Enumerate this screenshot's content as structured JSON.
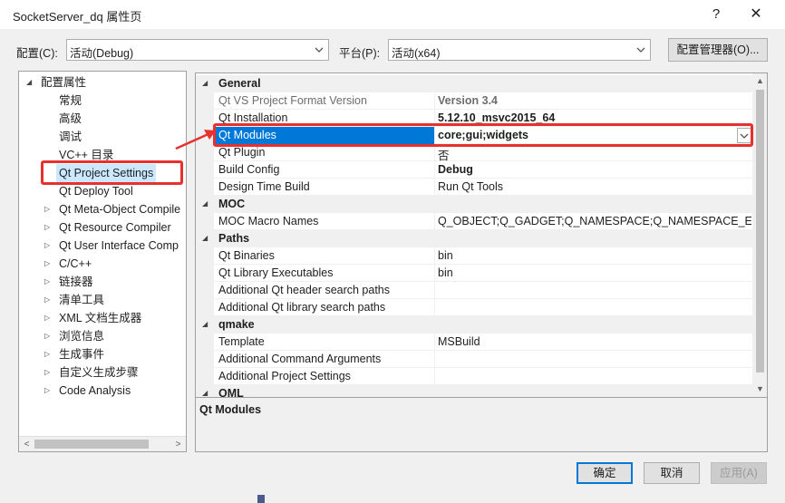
{
  "window": {
    "title": "SocketServer_dq 属性页",
    "help_glyph": "?",
    "close_glyph": "✕"
  },
  "toolbar": {
    "config_label": "配置(C):",
    "config_value": "活动(Debug)",
    "platform_label": "平台(P):",
    "platform_value": "活动(x64)",
    "config_manager_label": "配置管理器(O)..."
  },
  "tree": {
    "root": "配置属性",
    "items": [
      {
        "label": "常规",
        "expandable": false
      },
      {
        "label": "高级",
        "expandable": false
      },
      {
        "label": "调试",
        "expandable": false
      },
      {
        "label": "VC++ 目录",
        "expandable": false
      },
      {
        "label": "Qt Project Settings",
        "expandable": false,
        "selected": true
      },
      {
        "label": "Qt Deploy Tool",
        "expandable": false
      },
      {
        "label": "Qt Meta-Object Compile",
        "expandable": true
      },
      {
        "label": "Qt Resource Compiler",
        "expandable": true
      },
      {
        "label": "Qt User Interface Comp",
        "expandable": true
      },
      {
        "label": "C/C++",
        "expandable": true
      },
      {
        "label": "链接器",
        "expandable": true
      },
      {
        "label": "清单工具",
        "expandable": true
      },
      {
        "label": "XML 文档生成器",
        "expandable": true
      },
      {
        "label": "浏览信息",
        "expandable": true
      },
      {
        "label": "生成事件",
        "expandable": true
      },
      {
        "label": "自定义生成步骤",
        "expandable": true
      },
      {
        "label": "Code Analysis",
        "expandable": true
      }
    ]
  },
  "grid": {
    "sections": [
      {
        "name": "General",
        "rows": [
          {
            "name": "Qt VS Project Format Version",
            "value": "Version 3.4",
            "disabled": true,
            "bold": true
          },
          {
            "name": "Qt Installation",
            "value": "5.12.10_msvc2015_64",
            "bold": true
          },
          {
            "name": "Qt Modules",
            "value": "core;gui;widgets",
            "bold": true,
            "selected": true
          },
          {
            "name": "Qt Plugin",
            "value": "否"
          },
          {
            "name": "Build Config",
            "value": "Debug",
            "bold": true
          },
          {
            "name": "Design Time Build",
            "value": "Run Qt Tools"
          }
        ]
      },
      {
        "name": "MOC",
        "rows": [
          {
            "name": "MOC Macro Names",
            "value": "Q_OBJECT;Q_GADGET;Q_NAMESPACE;Q_NAMESPACE_EXPORT"
          }
        ]
      },
      {
        "name": "Paths",
        "rows": [
          {
            "name": "Qt Binaries",
            "value": "bin"
          },
          {
            "name": "Qt Library Executables",
            "value": "bin"
          },
          {
            "name": "Additional Qt header search paths",
            "value": ""
          },
          {
            "name": "Additional Qt library search paths",
            "value": ""
          }
        ]
      },
      {
        "name": "qmake",
        "rows": [
          {
            "name": "Template",
            "value": "MSBuild"
          },
          {
            "name": "Additional Command Arguments",
            "value": ""
          },
          {
            "name": "Additional Project Settings",
            "value": ""
          }
        ]
      },
      {
        "name": "QML",
        "rows": []
      }
    ]
  },
  "description": {
    "title": "Qt Modules"
  },
  "buttons": {
    "ok": "确定",
    "cancel": "取消",
    "apply": "应用(A)"
  },
  "colors": {
    "selection": "#0078d7",
    "annotation": "#e8312f"
  }
}
